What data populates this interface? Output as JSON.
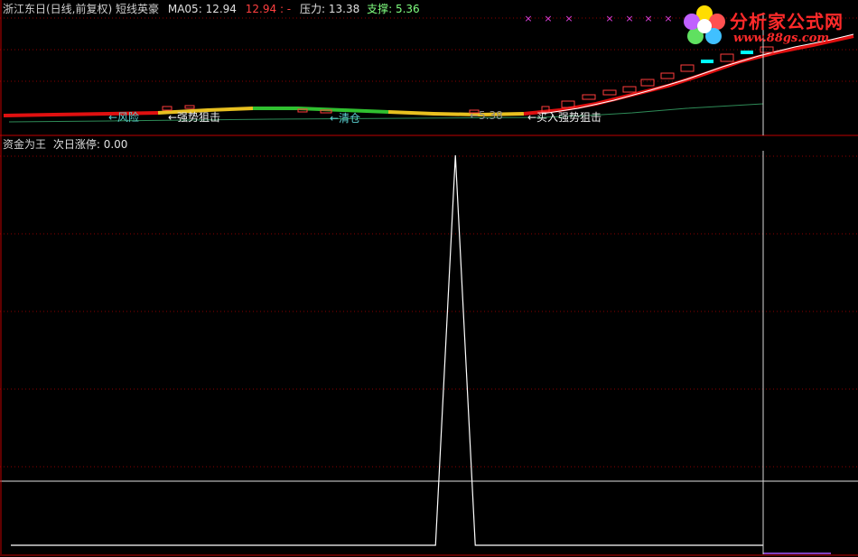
{
  "header": {
    "stock": "浙江东日(日线,前复权)",
    "indicator": "短线英豪",
    "ma_label": "MA05:",
    "ma_value1": "12.94",
    "ma_value2": "12.94",
    "ma_sep": ": -",
    "resistance_label": "压力:",
    "resistance_value": "13.38",
    "support_label": "支撑:",
    "support_value": "5.36"
  },
  "logo": {
    "name": "分析家公式网",
    "url": "www.88gs.com"
  },
  "annotations": {
    "risk": "←风险",
    "strong1": "←强势狙击",
    "clear": "←清仓",
    "price_tag": "←5.38",
    "buy": "←买入强势狙击"
  },
  "lower_panel": {
    "title": "资金为王",
    "series_label": "次日涨停:",
    "series_value": "0.00"
  },
  "colors": {
    "background": "#000000",
    "panel_border": "#c00000",
    "grid": "#8b0000",
    "up_candle": "#ff3c3c",
    "down_candle": "#00ffff",
    "ma_line": "#ffffff",
    "band_red": "#e01010",
    "band_yellow": "#e8c020",
    "band_green": "#30c030",
    "marker": "#e040e0",
    "lower_line": "#ffffff",
    "header_ma": "#e0e0e0",
    "header_red": "#ff4040",
    "header_green": "#80ff80"
  },
  "chart_data": [
    {
      "type": "candlestick",
      "title": "浙江东日(日线,前复权)",
      "series": [
        {
          "name": "MA05",
          "last": 12.94
        }
      ],
      "levels": {
        "压力": 13.38,
        "支撑": 5.36
      },
      "trend": "flat then sharp rise in the last third",
      "annotations": [
        "←风险",
        "←强势狙击",
        "←清仓",
        "←5.38",
        "←买入强势狙击"
      ]
    },
    {
      "type": "line",
      "title": "资金为王",
      "series": [
        {
          "name": "次日涨停",
          "values": [
            0,
            0,
            0,
            0,
            0,
            0,
            0,
            0,
            0,
            0,
            0,
            0,
            0,
            0,
            0,
            0,
            0,
            0,
            0,
            0,
            0,
            0,
            0,
            0,
            0,
            0,
            1,
            0,
            0,
            0,
            0,
            0,
            0,
            0,
            0,
            0,
            0,
            0,
            0,
            0,
            0,
            0,
            0,
            0,
            0
          ]
        }
      ],
      "ylim": [
        0,
        1
      ],
      "last": 0.0
    }
  ]
}
